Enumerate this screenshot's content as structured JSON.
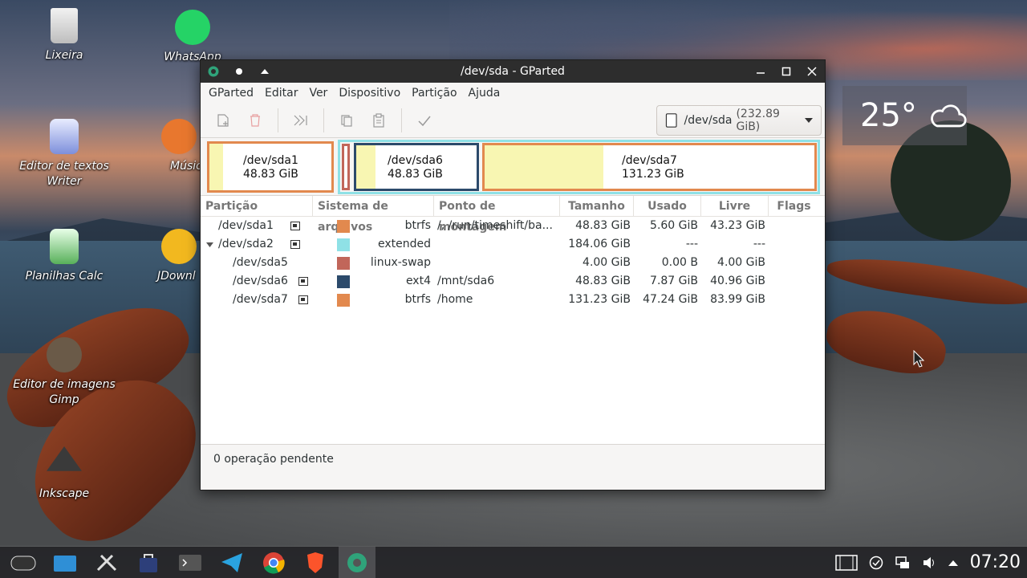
{
  "desktop": {
    "icons": [
      {
        "label": "Lixeira"
      },
      {
        "label": "WhatsApp"
      },
      {
        "label": "Editor de textos Writer"
      },
      {
        "label": "Músic"
      },
      {
        "label": "Planilhas Calc"
      },
      {
        "label": "JDownl"
      },
      {
        "label": "Editor de imagens Gimp"
      },
      {
        "label": "Inkscape"
      }
    ],
    "weather": {
      "temp": "25°",
      "icon": "cloud-icon"
    }
  },
  "window": {
    "title": "/dev/sda - GParted",
    "menu": [
      "GParted",
      "Editar",
      "Ver",
      "Dispositivo",
      "Partição",
      "Ajuda"
    ],
    "device": {
      "name": "/dev/sda",
      "size": "(232.89 GiB)"
    },
    "map": [
      {
        "name": "/dev/sda1",
        "size": "48.83 GiB",
        "used_fraction": 0.115,
        "color": "#e2894e"
      },
      {
        "name": "/dev/sda6",
        "size": "48.83 GiB",
        "used_fraction": 0.161,
        "color": "#2c4a6b"
      },
      {
        "name": "/dev/sda7",
        "size": "131.23 GiB",
        "used_fraction": 0.36,
        "color": "#e2894e"
      }
    ],
    "extended_color": "#8fe1e6",
    "swap_color": "#c1665a",
    "columns": [
      "Partição",
      "Sistema de arquivos",
      "Ponto de montagem",
      "Tamanho",
      "Usado",
      "Livre",
      "Flags"
    ],
    "rows": [
      {
        "partition": "/dev/sda1",
        "fs": "btrfs",
        "color": "#e2894e",
        "mount": "/, /run/timeshift/ba...",
        "size": "48.83 GiB",
        "used": "5.60 GiB",
        "free": "43.23 GiB",
        "flags": "",
        "lock": true,
        "indent": 0
      },
      {
        "partition": "/dev/sda2",
        "fs": "extended",
        "color": "#8fe1e6",
        "mount": "",
        "size": "184.06 GiB",
        "used": "---",
        "free": "---",
        "flags": "",
        "lock": true,
        "indent": 0,
        "expander": true
      },
      {
        "partition": "/dev/sda5",
        "fs": "linux-swap",
        "color": "#c1665a",
        "mount": "",
        "size": "4.00 GiB",
        "used": "0.00 B",
        "free": "4.00 GiB",
        "flags": "",
        "lock": false,
        "indent": 1
      },
      {
        "partition": "/dev/sda6",
        "fs": "ext4",
        "color": "#2c4a6b",
        "mount": "/mnt/sda6",
        "size": "48.83 GiB",
        "used": "7.87 GiB",
        "free": "40.96 GiB",
        "flags": "",
        "lock": true,
        "indent": 1
      },
      {
        "partition": "/dev/sda7",
        "fs": "btrfs",
        "color": "#e2894e",
        "mount": "/home",
        "size": "131.23 GiB",
        "used": "47.24 GiB",
        "free": "83.99 GiB",
        "flags": "",
        "lock": true,
        "indent": 1
      }
    ],
    "status": "0 operação pendente"
  },
  "taskbar": {
    "clock": "07:20"
  }
}
